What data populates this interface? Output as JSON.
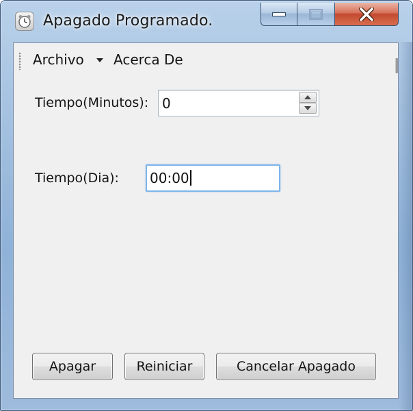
{
  "window": {
    "title": "Apagado Programado.",
    "icon": "alarm-clock-icon"
  },
  "caption_buttons": {
    "minimize_icon": "minimize-icon",
    "maximize_icon": "maximize-icon",
    "close_icon": "close-icon"
  },
  "menu": {
    "items": [
      {
        "label": "Archivo",
        "has_dropdown": true
      },
      {
        "label": "Acerca De",
        "has_dropdown": false
      }
    ]
  },
  "form": {
    "minutes_label": "Tiempo(Minutos):",
    "minutes_value": "0",
    "day_label": "Tiempo(Dia):",
    "day_value": "00:00"
  },
  "buttons": {
    "shutdown": "Apagar",
    "restart": "Reiniciar",
    "cancel": "Cancelar Apagado"
  },
  "colors": {
    "client_background": "#f0f0f0",
    "focus_border": "#7eb4ea",
    "close_button": "#c24a30"
  }
}
